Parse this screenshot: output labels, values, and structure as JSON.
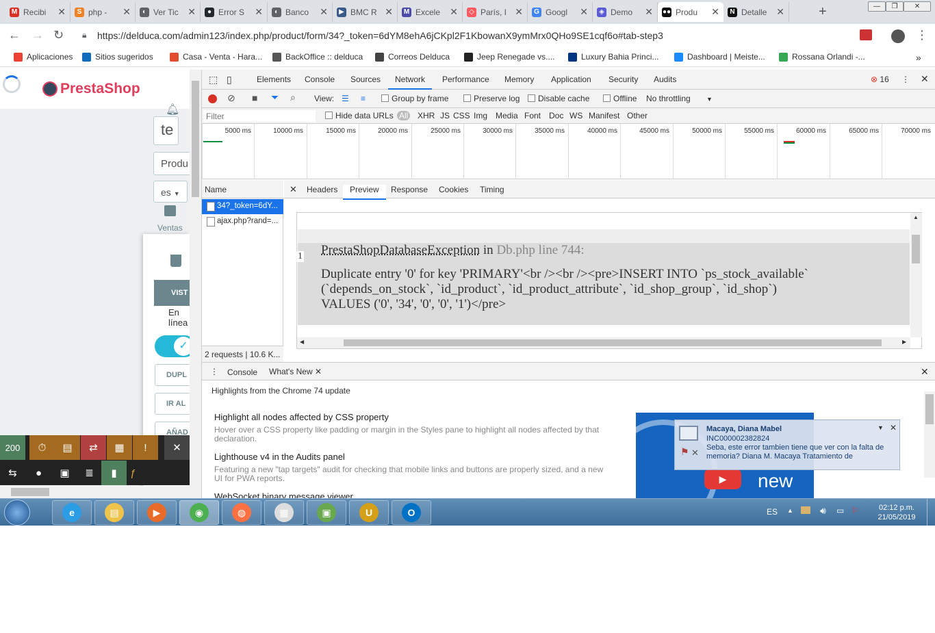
{
  "browser": {
    "tabs": [
      {
        "label": "Recibi",
        "icon": "gmail-icon",
        "color": "#d93025",
        "glyph": "M"
      },
      {
        "label": "php -",
        "icon": "stackoverflow-icon",
        "color": "#f48024",
        "glyph": "S"
      },
      {
        "label": "Ver Tic",
        "icon": "globe-icon",
        "color": "#5f6368",
        "glyph": "◐"
      },
      {
        "label": "Error S",
        "icon": "github-icon",
        "color": "#24292e",
        "glyph": "●"
      },
      {
        "label": "Banco",
        "icon": "globe-icon",
        "color": "#5f6368",
        "glyph": "◐"
      },
      {
        "label": "BMC R",
        "icon": "bmc-icon",
        "color": "#3b5a8a",
        "glyph": "▶"
      },
      {
        "label": "Excele",
        "icon": "excel-icon",
        "color": "#4a4aa8",
        "glyph": "M"
      },
      {
        "label": "París, I",
        "icon": "airbnb-icon",
        "color": "#ff5a5f",
        "glyph": "◇"
      },
      {
        "label": "Googl",
        "icon": "google-translate-icon",
        "color": "#4285f4",
        "glyph": "G"
      },
      {
        "label": "Demo",
        "icon": "demo-icon",
        "color": "#5b5bd6",
        "glyph": "◈"
      },
      {
        "label": "Produ",
        "icon": "prestashop-icon",
        "color": "#111111",
        "glyph": "●●",
        "active": true
      },
      {
        "label": "Detalle",
        "icon": "notion-icon",
        "color": "#111111",
        "glyph": "N"
      }
    ],
    "window_buttons": [
      "—",
      "❐",
      "✕"
    ],
    "url": "https://delduca.com/admin123/index.php/product/form/34?_token=6dYM8ehA6jCKpl2F1KbowanX9ymMrx0QHo9SE1cqf6o#tab-step3",
    "bookmarks": [
      {
        "label": "Aplicaciones",
        "icon": "apps-grid-icon",
        "color": "#ea4335"
      },
      {
        "label": "Sitios sugeridos",
        "icon": "bing-icon",
        "color": "#0f6cbd"
      },
      {
        "label": "Casa - Venta - Hara...",
        "icon": "pin-icon",
        "color": "#e04e2f"
      },
      {
        "label": "BackOffice :: delduca",
        "icon": "globe-icon",
        "color": "#555555"
      },
      {
        "label": "Correos Delduca",
        "icon": "outlook-icon",
        "color": "#444444"
      },
      {
        "label": "Jeep Renegade vs....",
        "icon": "motor-icon",
        "color": "#222222"
      },
      {
        "label": "Luxury Bahia Princi...",
        "icon": "booking-icon",
        "color": "#003580"
      },
      {
        "label": "Dashboard | Meiste...",
        "icon": "check-badge-icon",
        "color": "#1a8cff"
      },
      {
        "label": "Rossana Orlandi -...",
        "icon": "maps-icon",
        "color": "#34a853"
      }
    ]
  },
  "prestashop": {
    "logo": "PrestaShop",
    "search_text": "te",
    "product_field": "Produ",
    "language": "es",
    "ventas_label": "Ventas",
    "vista_label": "VIST",
    "status_line1": "En",
    "status_line2": "línea",
    "buttons": [
      "DUPL",
      "IR AL",
      "AÑAD"
    ],
    "debug_status": "200"
  },
  "devtools": {
    "tabs": [
      "Elements",
      "Console",
      "Sources",
      "Network",
      "Performance",
      "Memory",
      "Application",
      "Security",
      "Audits"
    ],
    "active_tab": "Network",
    "error_count": "16",
    "toolbar": {
      "view_label": "View:",
      "group_by_frame": "Group by frame",
      "preserve_log": "Preserve log",
      "disable_cache": "Disable cache",
      "offline": "Offline",
      "throttling": "No throttling"
    },
    "filter": {
      "placeholder": "Filter",
      "hide_data_urls": "Hide data URLs",
      "types": [
        "All",
        "XHR",
        "JS",
        "CSS",
        "Img",
        "Media",
        "Font",
        "Doc",
        "WS",
        "Manifest",
        "Other"
      ]
    },
    "timeline_ticks": [
      "5000 ms",
      "10000 ms",
      "15000 ms",
      "20000 ms",
      "25000 ms",
      "30000 ms",
      "35000 ms",
      "40000 ms",
      "45000 ms",
      "50000 ms",
      "55000 ms",
      "60000 ms",
      "65000 ms",
      "70000 ms"
    ],
    "requests": {
      "header": "Name",
      "items": [
        "34?_token=6dY...",
        "ajax.php?rand=..."
      ],
      "status": "2 requests | 10.6 K..."
    },
    "detail_tabs": [
      "Headers",
      "Preview",
      "Response",
      "Cookies",
      "Timing"
    ],
    "active_detail_tab": "Preview",
    "preview": {
      "line_number": "1",
      "exception": "PrestaShopDatabaseException",
      "in_word": "in",
      "location": "Db.php line 744:",
      "line1": "Duplicate entry '0' for key 'PRIMARY'<br /><br /><pre>INSERT INTO `ps_stock_available`",
      "line2": "(`depends_on_stock`, `id_product`, `id_product_attribute`, `id_shop_group`, `id_shop`)",
      "line3": "VALUES ('0', '34', '0', '0', '1')</pre>"
    },
    "drawer": {
      "tabs": [
        "Console",
        "What's New"
      ],
      "active": "What's New",
      "headline": "Highlights from the Chrome 74 update",
      "items": [
        {
          "title": "Highlight all nodes affected by CSS property",
          "desc": "Hover over a CSS property like padding or margin in the Styles pane to highlight all nodes affected by that declaration."
        },
        {
          "title": "Lighthouse v4 in the Audits panel",
          "desc": "Featuring a new \"tap targets\" audit for checking that mobile links and buttons are properly sized, and a new UI for PWA reports."
        },
        {
          "title": "WebSocket binary message viewer",
          "desc": ""
        }
      ],
      "promo_text": "new"
    }
  },
  "notification": {
    "sender": "Macaya, Diana Mabel",
    "ticket": "INC000002382824",
    "line1": "Seba, este error tambien tiene que ver con la falta de",
    "line2": "memoria?  Diana M. Macaya  Tratamiento de"
  },
  "taskbar": {
    "apps": [
      "internet-explorer-icon",
      "file-explorer-icon",
      "media-player-icon",
      "chrome-icon",
      "firefox-icon",
      "calculator-icon",
      "remote-desktop-icon",
      "ultraedit-icon",
      "outlook-icon"
    ],
    "language": "ES",
    "time": "02:12 p.m.",
    "date": "21/05/2019"
  },
  "colors": {
    "accent": "#1a73e8",
    "prestashop": "#e03e5c",
    "record": "#d93025"
  }
}
